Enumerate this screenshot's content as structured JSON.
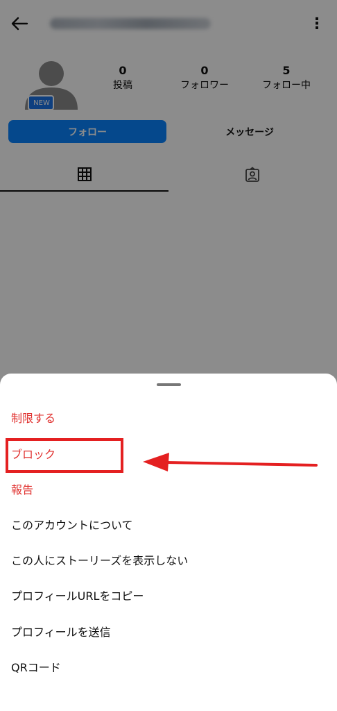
{
  "profile": {
    "avatar_badge": "NEW",
    "stats": [
      {
        "value": "0",
        "label": "投稿"
      },
      {
        "value": "0",
        "label": "フォロワー"
      },
      {
        "value": "5",
        "label": "フォロー中"
      }
    ],
    "follow_label": "フォロー",
    "message_label": "メッセージ",
    "tabs": [
      {
        "icon": "grid-icon",
        "active": true
      },
      {
        "icon": "tagged-photos-icon",
        "active": false
      }
    ]
  },
  "menu": {
    "items": [
      {
        "label": "制限する",
        "danger": true
      },
      {
        "label": "ブロック",
        "danger": true,
        "highlighted": true
      },
      {
        "label": "報告",
        "danger": true
      },
      {
        "label": "このアカウントについて",
        "danger": false
      },
      {
        "label": "この人にストーリーズを表示しない",
        "danger": false
      },
      {
        "label": "プロフィールURLをコピー",
        "danger": false
      },
      {
        "label": "プロフィールを送信",
        "danger": false
      },
      {
        "label": "QRコード",
        "danger": false
      }
    ]
  },
  "colors": {
    "accent": "#0a84ff",
    "danger": "#e0302e",
    "annotation": "#e42021"
  }
}
